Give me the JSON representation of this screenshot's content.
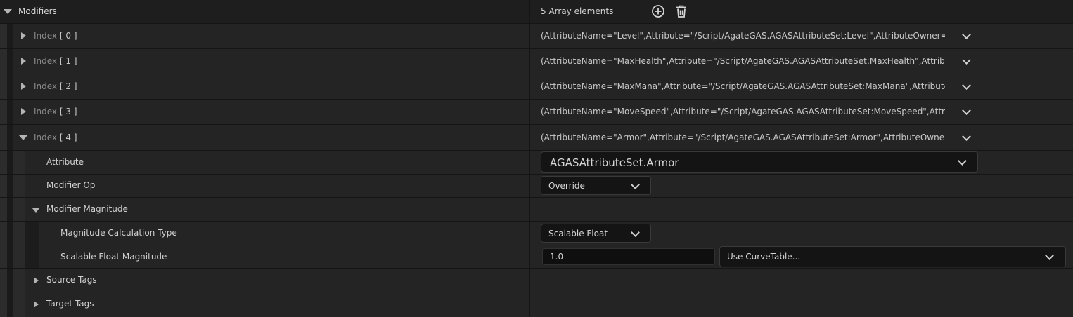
{
  "header": {
    "title": "Modifiers",
    "element_count_text": "5 Array elements",
    "add_icon": "plus-circle-icon",
    "delete_icon": "trash-icon"
  },
  "index_label": "Index",
  "elements": [
    {
      "index_text": "[ 0 ]",
      "value": "(AttributeName=\"Level\",Attribute=\"/Script/AgateGAS.AGASAttributeSet:Level\",AttributeOwner=/Script/AgateGAS.AGASAttributeSet)",
      "expanded": false
    },
    {
      "index_text": "[ 1 ]",
      "value": "(AttributeName=\"MaxHealth\",Attribute=\"/Script/AgateGAS.AGASAttributeSet:MaxHealth\",AttributeOwner=/Script/AgateGAS.AGASAttributeSet)",
      "expanded": false
    },
    {
      "index_text": "[ 2 ]",
      "value": "(AttributeName=\"MaxMana\",Attribute=\"/Script/AgateGAS.AGASAttributeSet:MaxMana\",AttributeOwner=/Script/AgateGAS.AGASAttributeSet)",
      "expanded": false
    },
    {
      "index_text": "[ 3 ]",
      "value": "(AttributeName=\"MoveSpeed\",Attribute=\"/Script/AgateGAS.AGASAttributeSet:MoveSpeed\",AttributeOwner=/Script/AgateGAS.AGASAttributeSet)",
      "expanded": false
    },
    {
      "index_text": "[ 4 ]",
      "value": "(AttributeName=\"Armor\",Attribute=\"/Script/AgateGAS.AGASAttributeSet:Armor\",AttributeOwner=None)",
      "expanded": true
    }
  ],
  "details": {
    "attribute_label": "Attribute",
    "attribute_value": "AGASAttributeSet.Armor",
    "modifier_op_label": "Modifier Op",
    "modifier_op_value": "Override",
    "modifier_magnitude_label": "Modifier Magnitude",
    "calc_type_label": "Magnitude Calculation Type",
    "calc_type_value": "Scalable Float",
    "scalable_float_label": "Scalable Float Magnitude",
    "scalable_float_value": "1.0",
    "curve_table_value": "Use CurveTable...",
    "source_tags_label": "Source Tags",
    "target_tags_label": "Target Tags"
  },
  "colors": {
    "background": "#242424",
    "header": "#1e1e1e",
    "field_background": "#141414"
  }
}
